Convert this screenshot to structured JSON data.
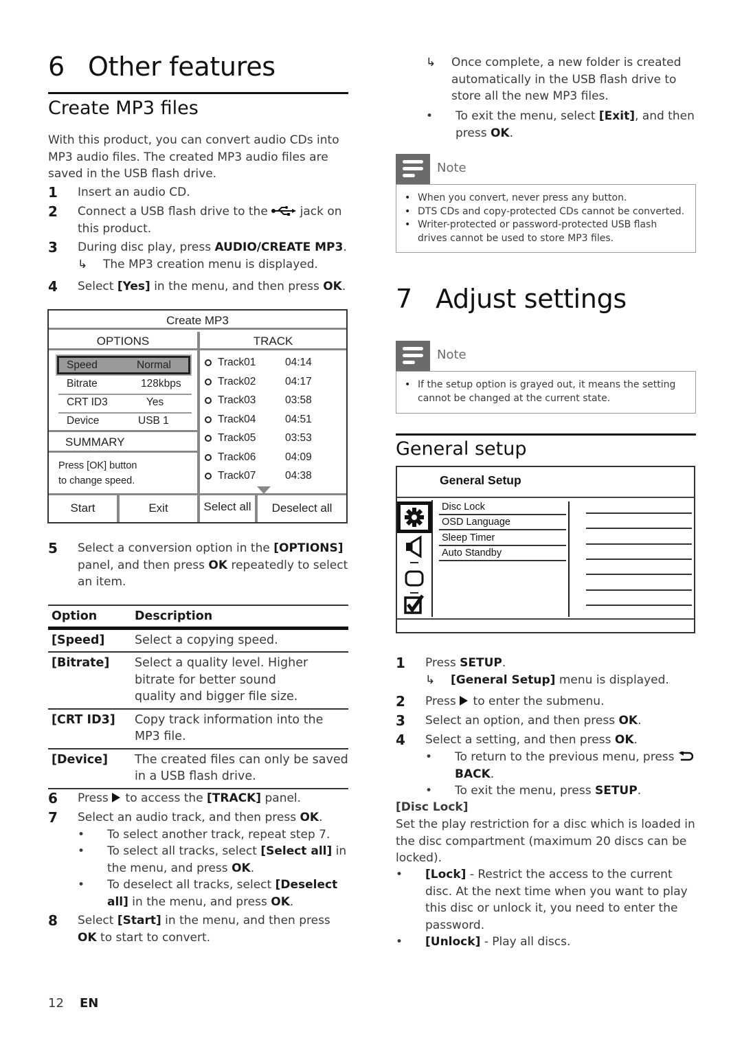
{
  "left": {
    "chapter": {
      "number": "6",
      "title": "Other features"
    },
    "section": "Create MP3 files",
    "intro": "With this product, you can convert audio CDs into MP3 audio files. The created MP3 audio files are saved in the USB flash drive.",
    "steps": [
      {
        "n": "1",
        "text": "Insert an audio CD."
      },
      {
        "n": "2",
        "pre": "Connect a USB flash drive to the ",
        "icon": "usb-icon",
        "post": " jack on this product."
      },
      {
        "n": "3",
        "pre": "During disc play, press ",
        "bold": "AUDIO/CREATE MP3",
        "post": ".",
        "result": "The MP3 creation menu is displayed."
      },
      {
        "n": "4",
        "pre": "Select ",
        "bold": "[Yes]",
        "mid": " in the menu, and then press ",
        "bold2": "OK",
        "post": "."
      },
      {
        "n": "5",
        "pre": "Select a conversion option in the ",
        "bold": "[OPTIONS]",
        "mid": " panel, and then press ",
        "bold2": "OK",
        "post": " repeatedly to select an item."
      },
      {
        "n": "6",
        "pre": "Press ",
        "mid": " to access the ",
        "bold": "[TRACK]",
        "post": " panel."
      },
      {
        "n": "7",
        "pre": "Select an audio track, and then press ",
        "bold": "OK",
        "post": "."
      },
      {
        "n": "8",
        "pre": "Select ",
        "bold": "[Start]",
        "mid": " in the menu, and then press ",
        "bold2": "OK",
        "post": " to start to convert."
      }
    ],
    "step7_bullets": [
      {
        "pre": "To select another track, repeat step 7."
      },
      {
        "pre": "To select all tracks, select ",
        "bold": "[Select all]",
        "mid": " in the menu, and press ",
        "bold2": "OK",
        "post": "."
      },
      {
        "pre": "To deselect all tracks, select ",
        "bold": "[Deselect all]",
        "mid": " in the menu, and press ",
        "bold2": "OK",
        "post": "."
      }
    ],
    "mp3_menu": {
      "title": "Create MP3",
      "options_header": "OPTIONS",
      "track_header": "TRACK",
      "options": [
        {
          "key": "Speed",
          "value": "Normal",
          "selected": true
        },
        {
          "key": "Bitrate",
          "value": "128kbps"
        },
        {
          "key": "CRT ID3",
          "value": "Yes"
        },
        {
          "key": "Device",
          "value": "USB 1"
        }
      ],
      "summary_header": "SUMMARY",
      "summary_text_1": "Press [OK] button",
      "summary_text_2": "to change speed.",
      "tracks": [
        {
          "name": "Track01",
          "duration": "04:14"
        },
        {
          "name": "Track02",
          "duration": "04:17"
        },
        {
          "name": "Track03",
          "duration": "03:58"
        },
        {
          "name": "Track04",
          "duration": "04:51"
        },
        {
          "name": "Track05",
          "duration": "03:53"
        },
        {
          "name": "Track06",
          "duration": "04:09"
        },
        {
          "name": "Track07",
          "duration": "04:38"
        }
      ],
      "buttons": {
        "start": "Start",
        "exit": "Exit",
        "select_all": "Select all",
        "deselect_all": "Deselect all"
      }
    },
    "option_table": {
      "headers": [
        "Option",
        "Description"
      ],
      "rows": [
        {
          "option": "[Speed]",
          "description": "Select a copying speed."
        },
        {
          "option": "[Bitrate]",
          "description": "Select a quality level. Higher bitrate for better sound quality and bigger file size."
        },
        {
          "option": "[CRT ID3]",
          "description": "Copy track information into the MP3 file."
        },
        {
          "option": "[Device]",
          "description": "The created files can only be saved in a USB flash drive."
        }
      ]
    }
  },
  "right": {
    "step8_result": "Once complete, a new folder is created automatically in the USB flash drive to store all the new MP3 files.",
    "exit_bullet": {
      "pre": "To exit the menu, select ",
      "bold": "[Exit]",
      "mid": ", and then press ",
      "bold2": "OK",
      "post": "."
    },
    "note1": {
      "label": "Note",
      "items": [
        "When you convert, never press any button.",
        "DTS CDs and copy-protected CDs cannot be converted.",
        "Writer-protected or password-protected USB flash drives cannot be used to store MP3 files."
      ]
    },
    "chapter": {
      "number": "7",
      "title": "Adjust settings"
    },
    "note2": {
      "label": "Note",
      "items": [
        "If the setup option is grayed out, it means the setting cannot be changed at the current state."
      ]
    },
    "section": "General setup",
    "setup_menu": {
      "title": "General Setup",
      "icons": [
        "gear-icon",
        "speaker-icon",
        "screen-icon",
        "checkbox-icon"
      ],
      "items": [
        "Disc Lock",
        "OSD Language",
        "Sleep Timer",
        "Auto Standby"
      ]
    },
    "steps": [
      {
        "n": "1",
        "pre": "Press ",
        "bold": "SETUP",
        "post": ".",
        "result_bold": "[General Setup]",
        "result_post": " menu is displayed."
      },
      {
        "n": "2",
        "pre": "Press ",
        "post": " to enter the submenu."
      },
      {
        "n": "3",
        "pre": "Select an option, and then press ",
        "bold": "OK",
        "post": "."
      },
      {
        "n": "4",
        "pre": "Select a setting, and then press ",
        "bold": "OK",
        "post": "."
      }
    ],
    "step4_bullets": [
      {
        "pre": "To return to the previous menu, press ",
        "bold": "BACK",
        "post": "."
      },
      {
        "pre": "To exit the menu, press ",
        "bold": "SETUP",
        "post": "."
      }
    ],
    "disc_lock": {
      "heading": "[Disc Lock]",
      "description": "Set the play restriction for a disc which is loaded in the disc compartment (maximum 20 discs can be locked).",
      "options": [
        {
          "bold": "[Lock]",
          "text": " - Restrict the access to the current disc. At the next time when you want to play this disc or unlock it, you need to enter the password."
        },
        {
          "bold": "[Unlock]",
          "text": " - Play all discs."
        }
      ]
    }
  },
  "footer": {
    "page": "12",
    "lang": "EN"
  }
}
